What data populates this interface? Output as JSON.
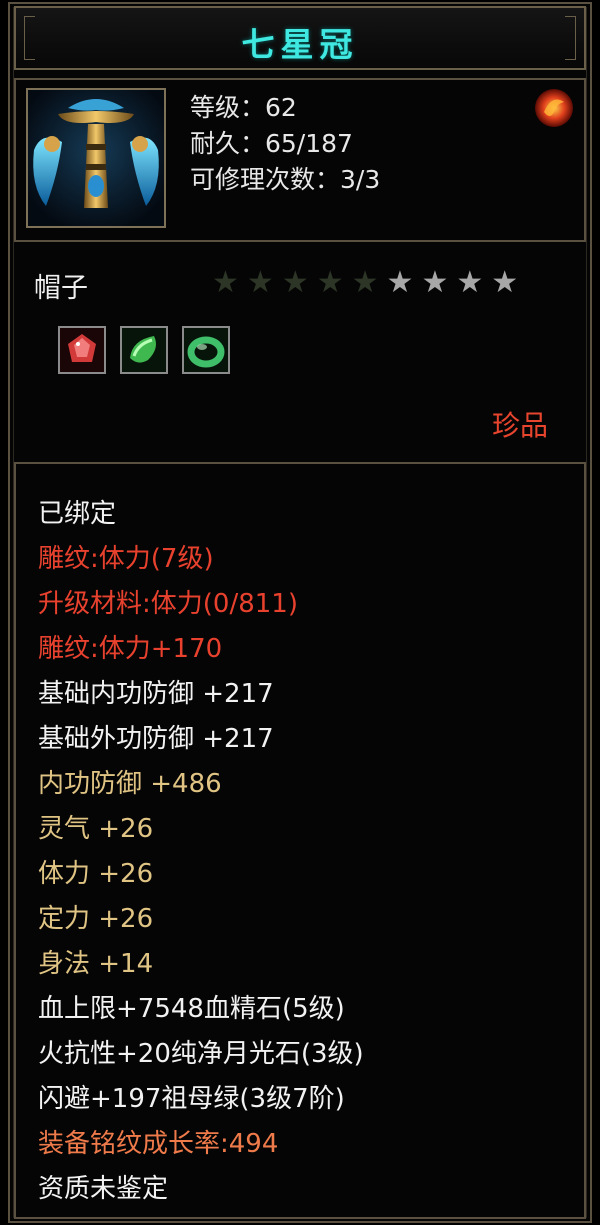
{
  "item": {
    "name": "七星冠",
    "level_line": "等级：62",
    "durability_line": "耐久：65/187",
    "repair_line": "可修理次数：3/3",
    "type": "帽子",
    "rarity": "珍品"
  },
  "stars": {
    "filled": 5,
    "total": 9
  },
  "attributes": [
    {
      "text": "已绑定",
      "color": "white"
    },
    {
      "text": "雕纹:体力(7级)",
      "color": "red"
    },
    {
      "text": "升级材料:体力(0/811)",
      "color": "red"
    },
    {
      "text": "雕纹:体力+170",
      "color": "red"
    },
    {
      "text": "基础内功防御  +217",
      "color": "white"
    },
    {
      "text": "基础外功防御  +217",
      "color": "white"
    },
    {
      "text": "内功防御  +486",
      "color": "gold"
    },
    {
      "text": "灵气  +26",
      "color": "gold"
    },
    {
      "text": "体力  +26",
      "color": "gold"
    },
    {
      "text": "定力  +26",
      "color": "gold"
    },
    {
      "text": "身法  +14",
      "color": "gold"
    },
    {
      "text": "血上限+7548血精石(5级)",
      "color": "white"
    },
    {
      "text": "火抗性+20纯净月光石(3级)",
      "color": "white"
    },
    {
      "text": "闪避+197祖母绿(3级7阶)",
      "color": "white"
    },
    {
      "text": "装备铭纹成长率:494",
      "color": "orange"
    },
    {
      "text": "资质未鉴定",
      "color": "white"
    }
  ],
  "colors": {
    "title": "#3fe8e0",
    "white": "#f2f2f2",
    "red": "#e8412e",
    "gold": "#e0c484",
    "orange": "#ef7a4a",
    "border": "#5a5140"
  },
  "icons": {
    "item": "hat-icon",
    "corner": "red-gem-icon",
    "slots": [
      "ruby-gem-icon",
      "green-jade-icon",
      "jade-ring-icon"
    ]
  }
}
